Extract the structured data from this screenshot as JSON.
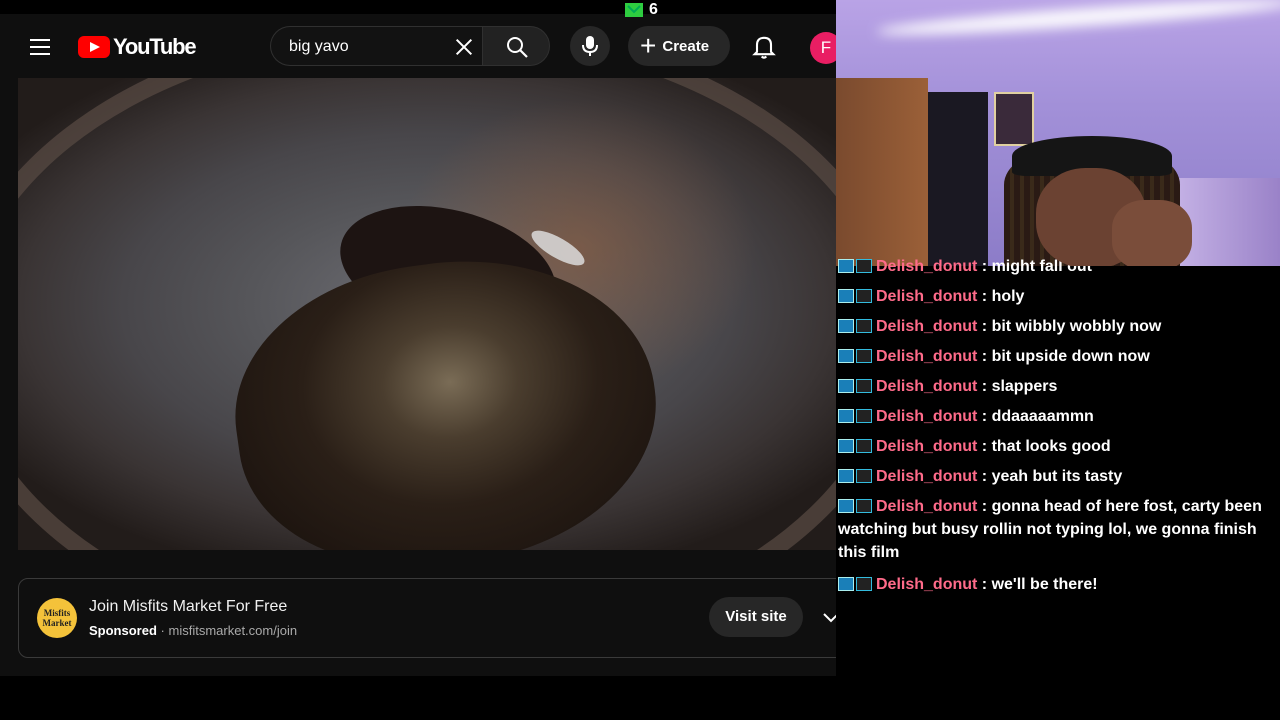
{
  "youtube": {
    "logo_text": "YouTube",
    "search": {
      "value": "big yavo",
      "placeholder": "Search"
    },
    "create_label": "Create",
    "avatar_initial": "F",
    "notification_count": "6"
  },
  "ad": {
    "logo_line1": "Misfits",
    "logo_line2": "Market",
    "title": "Join Misfits Market For Free",
    "sponsored": "Sponsored",
    "separator": "·",
    "url": "misfitsmarket.com/join",
    "visit_label": "Visit site"
  },
  "chat": {
    "messages": [
      {
        "user": "Delish_donut",
        "sep": " : ",
        "text": "might fall out"
      },
      {
        "user": "Delish_donut",
        "sep": " : ",
        "text": "holy"
      },
      {
        "user": "Delish_donut",
        "sep": " : ",
        "text": "bit wibbly wobbly now"
      },
      {
        "user": "Delish_donut",
        "sep": " : ",
        "text": "bit upside down now"
      },
      {
        "user": "Delish_donut",
        "sep": " : ",
        "text": "slappers"
      },
      {
        "user": "Delish_donut",
        "sep": " : ",
        "text": "ddaaaaammn"
      },
      {
        "user": "Delish_donut",
        "sep": " : ",
        "text": "that looks good"
      },
      {
        "user": "Delish_donut",
        "sep": " : ",
        "text": "yeah but its tasty"
      },
      {
        "user": "Delish_donut",
        "sep": " : ",
        "text": "gonna head of here fost, carty been watching but busy rollin not typing lol, we gonna finish this film"
      },
      {
        "user": "Delish_donut",
        "sep": " : ",
        "text": "we'll be there!"
      }
    ]
  },
  "colors": {
    "username": "#ff6b8a",
    "brand_red": "#ff0000",
    "avatar": "#e91e63"
  }
}
